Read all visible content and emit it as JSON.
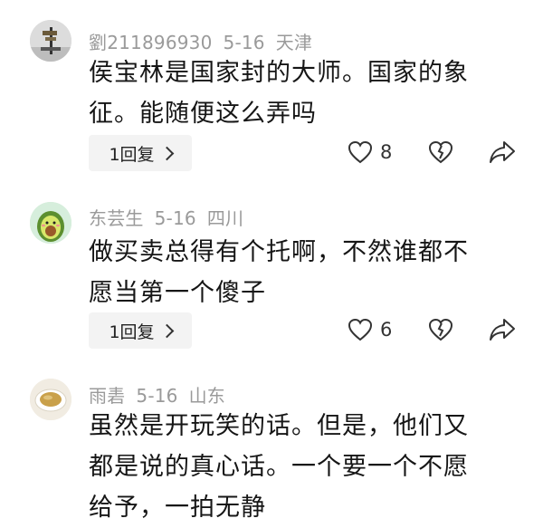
{
  "comments": [
    {
      "username": "劉211896930",
      "date": "5-16",
      "location": "天津",
      "text_lines": [
        "侯宝林是国家封的大师。国家的象",
        "征。能随便这么弄吗"
      ],
      "reply_label": "1回复",
      "likes": "8",
      "avatar_icon": "signpost-photo-avatar"
    },
    {
      "username": "东芸生",
      "date": "5-16",
      "location": "四川",
      "text_lines": [
        "做买卖总得有个托啊，不然谁都不",
        "愿当第一个傻子"
      ],
      "reply_label": "1回复",
      "likes": "6",
      "avatar_icon": "avocado-avatar"
    },
    {
      "username": "雨砉",
      "date": "5-16",
      "location": "山东",
      "text_lines": [
        "虽然是开玩笑的话。但是，他们又",
        "都是说的真心话。一个要一个不愿",
        "给予，一拍无静"
      ],
      "avatar_icon": "tea-cup-avatar"
    }
  ],
  "icons": {
    "like": "heart-outline-icon",
    "dislike": "broken-heart-icon",
    "share": "share-arrow-icon",
    "reply_chevron": "chevron-right-icon"
  },
  "colors": {
    "meta_text": "#9a9a9a",
    "body_text": "#161616",
    "reply_bg": "#f3f3f3"
  }
}
